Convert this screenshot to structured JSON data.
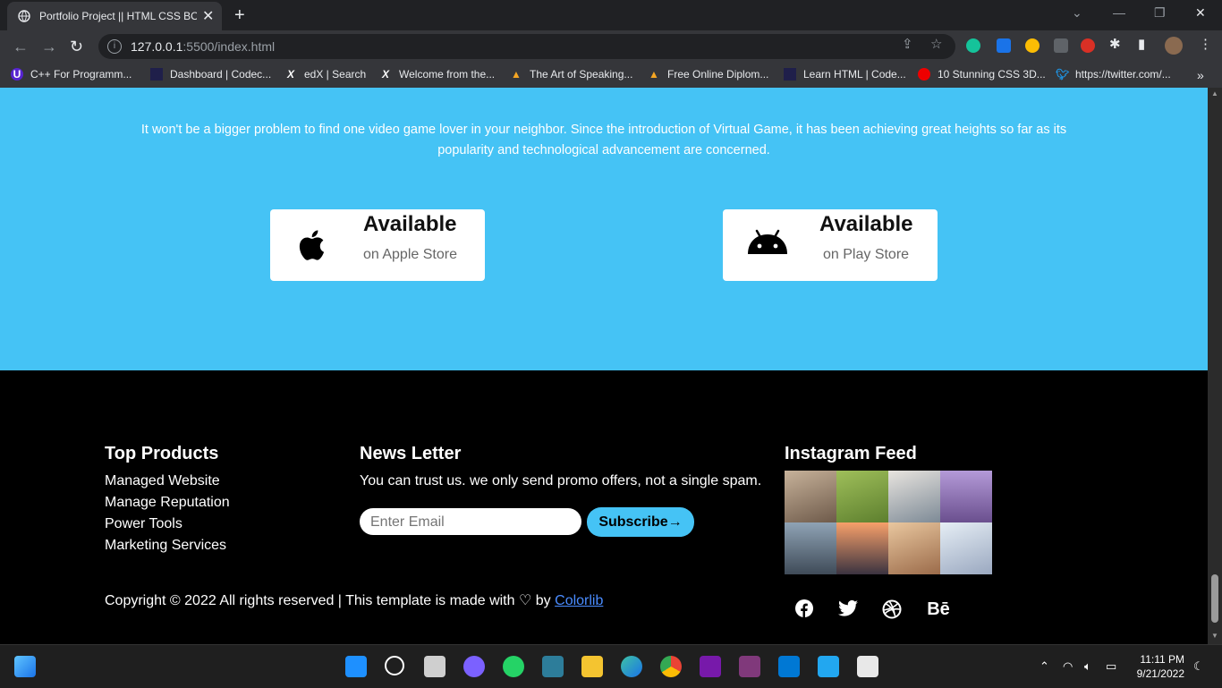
{
  "browser": {
    "tab_title": "Portfolio Project || HTML CSS BOOTSTRAP",
    "url_host": "127.0.0.1",
    "url_rest": ":5500/index.html",
    "bookmarks": [
      {
        "label": "C++ For Programm...",
        "icon": "udemy-icon"
      },
      {
        "label": "Dashboard | Codec...",
        "icon": "codecademy-icon"
      },
      {
        "label": "edX | Search",
        "icon": "edx-icon"
      },
      {
        "label": "Welcome from the...",
        "icon": "edx-icon"
      },
      {
        "label": "The Art of Speaking...",
        "icon": "alison-icon"
      },
      {
        "label": "Free Online Diplom...",
        "icon": "alison-icon"
      },
      {
        "label": "Learn HTML | Code...",
        "icon": "codecademy-icon"
      },
      {
        "label": "10 Stunning CSS 3D...",
        "icon": "youtube-icon"
      },
      {
        "label": "https://twitter.com/...",
        "icon": "twitter-icon"
      }
    ]
  },
  "hero": {
    "description": "It won't be a bigger problem to find one video game lover in your neighbor. Since the introduction of Virtual Game, it has been achieving great heights so far as its popularity and technological advancement are concerned.",
    "apple": {
      "big": "Available",
      "small": "on Apple Store"
    },
    "play": {
      "big": "Available",
      "small": "on Play Store"
    }
  },
  "footer": {
    "products_title": "Top Products",
    "products": [
      "Managed Website",
      "Manage Reputation",
      "Power Tools",
      "Marketing Services"
    ],
    "newsletter_title": "News Letter",
    "newsletter_text": "You can trust us. we only send promo offers, not a single spam.",
    "email_placeholder": "Enter Email",
    "subscribe_label": "Subscribe→",
    "instagram_title": "Instagram Feed",
    "copyright_prefix": "Copyright © 2022 All rights reserved | This template is made with",
    "copyright_by": "by",
    "copyright_link": "Colorlib",
    "social": [
      "facebook-icon",
      "twitter-icon",
      "dribbble-icon",
      "behance-icon"
    ]
  },
  "taskbar": {
    "time": "11:11 PM",
    "date": "9/21/2022"
  },
  "colors": {
    "hero_bg": "#45c3f5",
    "footer_bg": "#000000",
    "accent": "#45c3f5"
  }
}
